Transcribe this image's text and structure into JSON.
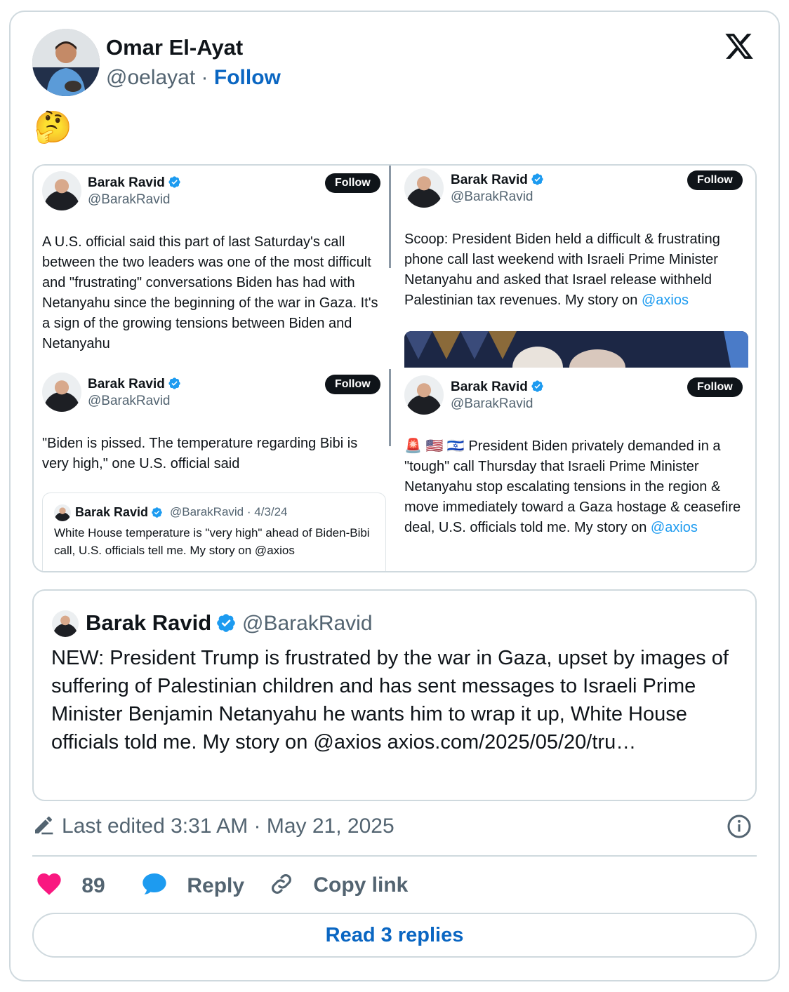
{
  "author": {
    "name": "Omar El-Ayat",
    "handle": "@oelayat",
    "separator": "·",
    "follow_label": "Follow"
  },
  "brand_icon": "x-logo-icon",
  "post_text": "🤔",
  "composite": {
    "panes": [
      {
        "name": "Barak Ravid",
        "handle": "@BarakRavid",
        "follow_label": "Follow",
        "text": "A U.S. official said this part of last Saturday's call between the two leaders was one of the most difficult and \"frustrating\" conversations Biden has had with Netanyahu since the beginning of the war in Gaza. It's a sign of the growing tensions between Biden and Netanyahu"
      },
      {
        "name": "Barak Ravid",
        "handle": "@BarakRavid",
        "follow_label": "Follow",
        "text": "Scoop: President Biden held a difficult & frustrating phone call last weekend with Israeli Prime Minister Netanyahu and asked that Israel release withheld Palestinian tax revenues. My story on ",
        "link": "@axios"
      },
      {
        "name": "Barak Ravid",
        "handle": "@BarakRavid",
        "follow_label": "Follow",
        "text": "\"Biden is pissed. The temperature regarding Bibi is very high,\" one U.S. official said",
        "inner_quote": {
          "name": "Barak Ravid",
          "handle_date": "@BarakRavid · 4/3/24",
          "text": "White House temperature is \"very high\" ahead of Biden-Bibi call, U.S. officials tell me. My story on @axios"
        }
      },
      {
        "name": "Barak Ravid",
        "handle": "@BarakRavid",
        "follow_label": "Follow",
        "emoji_prefix": "🚨 🇺🇸 🇮🇱",
        "text": "President Biden privately demanded in a \"tough\" call Thursday that Israeli Prime Minister Netanyahu stop escalating tensions in the region & move immediately toward a Gaza hostage & ceasefire deal, U.S. officials told me. My story on ",
        "link": "@axios"
      }
    ]
  },
  "quoted_tweet": {
    "name": "Barak Ravid",
    "handle": "@BarakRavid",
    "text": "NEW: President Trump is frustrated by the war in Gaza, upset by images of suffering of Palestinian children and has sent messages to Israeli Prime Minister Benjamin Netanyahu he wants him to wrap it up, White House officials told me. My story on @axios axios.com/2025/05/20/tru…"
  },
  "footer": {
    "edited_text": "Last edited 3:31 AM · May 21, 2025",
    "like_count": "89",
    "reply_label": "Reply",
    "copy_link_label": "Copy link",
    "read_replies_label": "Read 3 replies"
  },
  "colors": {
    "accent": "#0a66c2",
    "link": "#1d9bf0",
    "like": "#f91880",
    "verified": "#1d9bf0",
    "border": "#cfd9de",
    "muted": "#536471"
  }
}
